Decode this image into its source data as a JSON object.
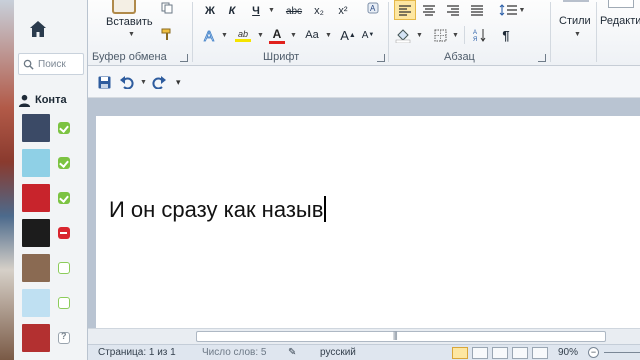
{
  "skype": {
    "search_placeholder": "Поиск",
    "contacts_label": "Конта",
    "contacts": [
      {
        "status": "online",
        "color": "#3b4a66"
      },
      {
        "status": "online",
        "color": "#8fd0e6"
      },
      {
        "status": "online",
        "color": "#c8242c"
      },
      {
        "status": "busy",
        "color": "#1c1c1c"
      },
      {
        "status": "offline",
        "color": "#8a6a52"
      },
      {
        "status": "offline",
        "color": "#bfe0f2"
      },
      {
        "status": "unknown",
        "color": "#b33030"
      }
    ]
  },
  "ribbon": {
    "paste_label": "Вставить",
    "clipboard_group": "Буфер обмена",
    "font_group": "Шрифт",
    "paragraph_group": "Абзац",
    "styles_label": "Стили",
    "editing_label": "Редакти",
    "bold": "Ж",
    "italic": "К",
    "underline": "Ч",
    "strike": "abc",
    "subscript": "x₂",
    "superscript": "x²",
    "case": "Aa",
    "grow": "A",
    "shrink": "A",
    "highlight_color": "#f5e400",
    "font_color": "#e0201c",
    "pilcrow": "¶"
  },
  "document": {
    "text": "И он сразу как назыв"
  },
  "statusbar": {
    "page": "Страница: 1 из 1",
    "words": "Число слов: 5",
    "language": "русский",
    "zoom": "90%"
  }
}
